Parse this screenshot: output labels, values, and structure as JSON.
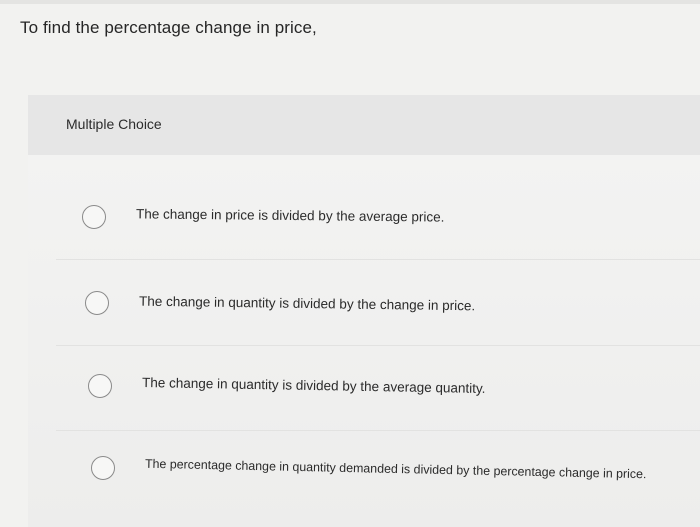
{
  "question": {
    "text": "To find the percentage change in price,"
  },
  "multiple_choice": {
    "label": "Multiple Choice",
    "options": [
      {
        "text": "The change in price is divided by the average price.",
        "selected": false
      },
      {
        "text": "The change in quantity is divided by the change in price.",
        "selected": false
      },
      {
        "text": "The change in quantity is divided by the average quantity.",
        "selected": false
      },
      {
        "text": "The percentage change in quantity demanded is divided by the percentage change in price.",
        "selected": false
      }
    ]
  }
}
